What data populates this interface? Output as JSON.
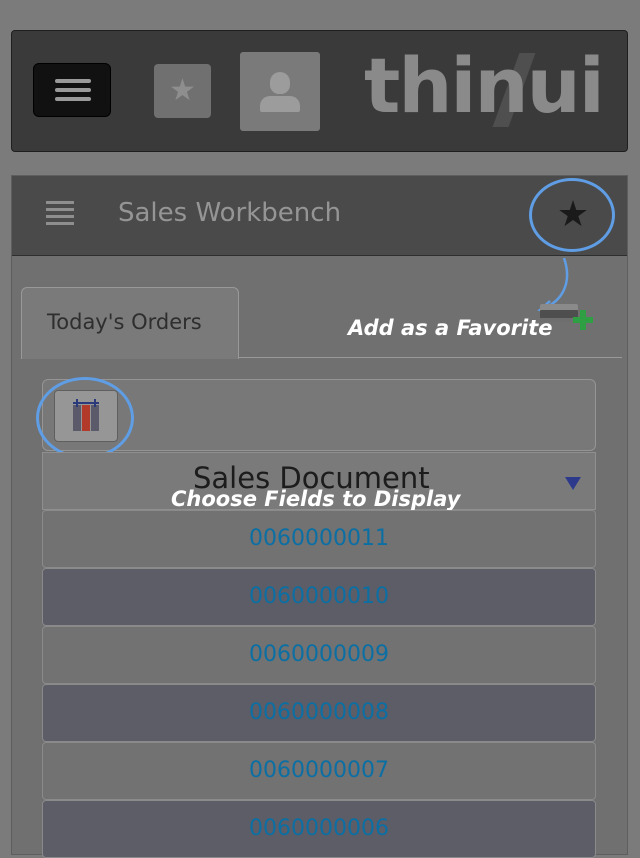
{
  "header": {
    "menu_icon": "hamburger-icon",
    "favorites_icon": "star-icon",
    "user_icon": "user-icon",
    "logo_text": "thinui"
  },
  "panel": {
    "title": "Sales Workbench",
    "menu_icon": "list-icon",
    "favorite_icon": "star-icon",
    "add_drawer_icon": "drawer-add-icon"
  },
  "tabs": [
    {
      "label": "Today's Orders"
    }
  ],
  "annotations": {
    "favorite": "Add as a Favorite",
    "fields": "Choose Fields to Display"
  },
  "toolbar": {
    "field_chooser_icon": "column-chooser-icon"
  },
  "table": {
    "column_header": "Sales Document",
    "sort_icon": "caret-down-icon",
    "rows": [
      "0060000011",
      "0060000010",
      "0060000009",
      "0060000008",
      "0060000007",
      "0060000006"
    ]
  },
  "colors": {
    "accent_circle": "#5f9de4",
    "link": "#0b6fa4",
    "add_green": "#2ea043"
  }
}
